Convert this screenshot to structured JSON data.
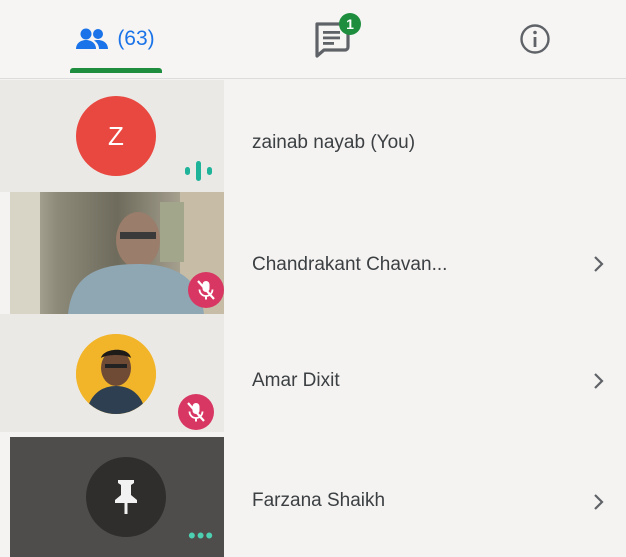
{
  "tabs": {
    "people_count": "(63)",
    "chat_badge": "1",
    "people_icon": "people-icon",
    "chat_icon": "chat-icon",
    "info_icon": "info-icon"
  },
  "participants": [
    {
      "name": "zainab nayab (You)",
      "avatar_letter": "Z",
      "avatar_color": "#e8483f",
      "status": "speaking",
      "has_chevron": false
    },
    {
      "name": "Chandrakant Chavan...",
      "status": "muted",
      "has_chevron": true
    },
    {
      "name": "Amar Dixit",
      "status": "muted",
      "has_chevron": true
    },
    {
      "name": "Farzana Shaikh",
      "status": "pinned-more",
      "has_chevron": true
    }
  ],
  "colors": {
    "accent": "#1a73e8",
    "tab_indicator": "#1e8e3e",
    "mute_red": "#d93763",
    "voice_green": "#1fb39a"
  }
}
